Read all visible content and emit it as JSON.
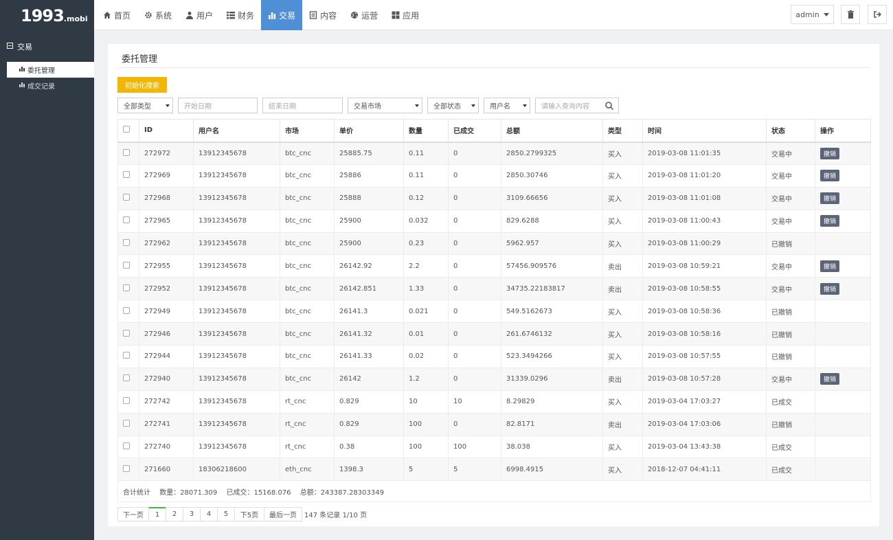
{
  "brand": {
    "big": "1993",
    "small": ".mobi"
  },
  "nav": [
    {
      "label": "首页",
      "icon": "home-icon"
    },
    {
      "label": "系统",
      "icon": "gear-icon"
    },
    {
      "label": "用户",
      "icon": "user-icon"
    },
    {
      "label": "财务",
      "icon": "list-icon"
    },
    {
      "label": "交易",
      "icon": "bar-chart-icon",
      "active": true
    },
    {
      "label": "内容",
      "icon": "document-icon"
    },
    {
      "label": "运营",
      "icon": "globe-icon"
    },
    {
      "label": "应用",
      "icon": "grid-icon"
    }
  ],
  "header": {
    "user": "admin"
  },
  "sidebar": {
    "section": "交易",
    "items": [
      {
        "label": "委托管理",
        "active": true
      },
      {
        "label": "成交记录",
        "active": false
      }
    ]
  },
  "page": {
    "title": "委托管理",
    "init_search": "初始化搜索"
  },
  "filters": {
    "type": "全部类型",
    "start_date": "开始日期",
    "end_date": "结束日期",
    "market": "交易市场",
    "status": "全部状态",
    "field": "用户名",
    "query": "请输入查询内容"
  },
  "table": {
    "headers": [
      "ID",
      "用户名",
      "市场",
      "单价",
      "数量",
      "已成交",
      "总额",
      "类型",
      "时间",
      "状态",
      "操作"
    ],
    "cancel_label": "撤销",
    "rows": [
      [
        "272972",
        "13912345678",
        "btc_cnc",
        "25885.75",
        "0.11",
        "0",
        "2850.2799325",
        "买入",
        "2019-03-08 11:01:35",
        "交易中",
        true
      ],
      [
        "272969",
        "13912345678",
        "btc_cnc",
        "25886",
        "0.11",
        "0",
        "2850.30746",
        "买入",
        "2019-03-08 11:01:20",
        "交易中",
        true
      ],
      [
        "272968",
        "13912345678",
        "btc_cnc",
        "25888",
        "0.12",
        "0",
        "3109.66656",
        "买入",
        "2019-03-08 11:01:08",
        "交易中",
        true
      ],
      [
        "272965",
        "13912345678",
        "btc_cnc",
        "25900",
        "0.032",
        "0",
        "829.6288",
        "买入",
        "2019-03-08 11:00:43",
        "交易中",
        true
      ],
      [
        "272962",
        "13912345678",
        "btc_cnc",
        "25900",
        "0.23",
        "0",
        "5962.957",
        "买入",
        "2019-03-08 11:00:29",
        "已撤销",
        false
      ],
      [
        "272955",
        "13912345678",
        "btc_cnc",
        "26142.92",
        "2.2",
        "0",
        "57456.909576",
        "卖出",
        "2019-03-08 10:59:21",
        "交易中",
        true
      ],
      [
        "272952",
        "13912345678",
        "btc_cnc",
        "26142.851",
        "1.33",
        "0",
        "34735.22183817",
        "卖出",
        "2019-03-08 10:58:55",
        "交易中",
        true
      ],
      [
        "272949",
        "13912345678",
        "btc_cnc",
        "26141.3",
        "0.021",
        "0",
        "549.5162673",
        "买入",
        "2019-03-08 10:58:36",
        "已撤销",
        false
      ],
      [
        "272946",
        "13912345678",
        "btc_cnc",
        "26141.32",
        "0.01",
        "0",
        "261.6746132",
        "买入",
        "2019-03-08 10:58:16",
        "已撤销",
        false
      ],
      [
        "272944",
        "13912345678",
        "btc_cnc",
        "26141.33",
        "0.02",
        "0",
        "523.3494266",
        "买入",
        "2019-03-08 10:57:55",
        "已撤销",
        false
      ],
      [
        "272940",
        "13912345678",
        "btc_cnc",
        "26142",
        "1.2",
        "0",
        "31339.0296",
        "卖出",
        "2019-03-08 10:57:28",
        "交易中",
        true
      ],
      [
        "272742",
        "13912345678",
        "rt_cnc",
        "0.829",
        "10",
        "10",
        "8.29829",
        "买入",
        "2019-03-04 17:03:27",
        "已成交",
        false
      ],
      [
        "272741",
        "13912345678",
        "rt_cnc",
        "0.829",
        "100",
        "0",
        "82.8171",
        "卖出",
        "2019-03-04 17:03:06",
        "已撤销",
        false
      ],
      [
        "272740",
        "13912345678",
        "rt_cnc",
        "0.38",
        "100",
        "100",
        "38.038",
        "买入",
        "2019-03-04 13:43:38",
        "已成交",
        false
      ],
      [
        "271660",
        "18306218600",
        "eth_cnc",
        "1398.3",
        "5",
        "5",
        "6998.4915",
        "买入",
        "2018-12-07 04:41:11",
        "已成交",
        false
      ]
    ]
  },
  "summary": {
    "label": "合计统计",
    "qty": "数量：28071.309",
    "done": "已成交：15168.076",
    "total": "总额：243387.28303349"
  },
  "pager": {
    "prev": "下一页",
    "pages": [
      "1",
      "2",
      "3",
      "4",
      "5"
    ],
    "next5": "下5页",
    "last": "最后一页",
    "info": "147 条记录 1/10 页"
  }
}
